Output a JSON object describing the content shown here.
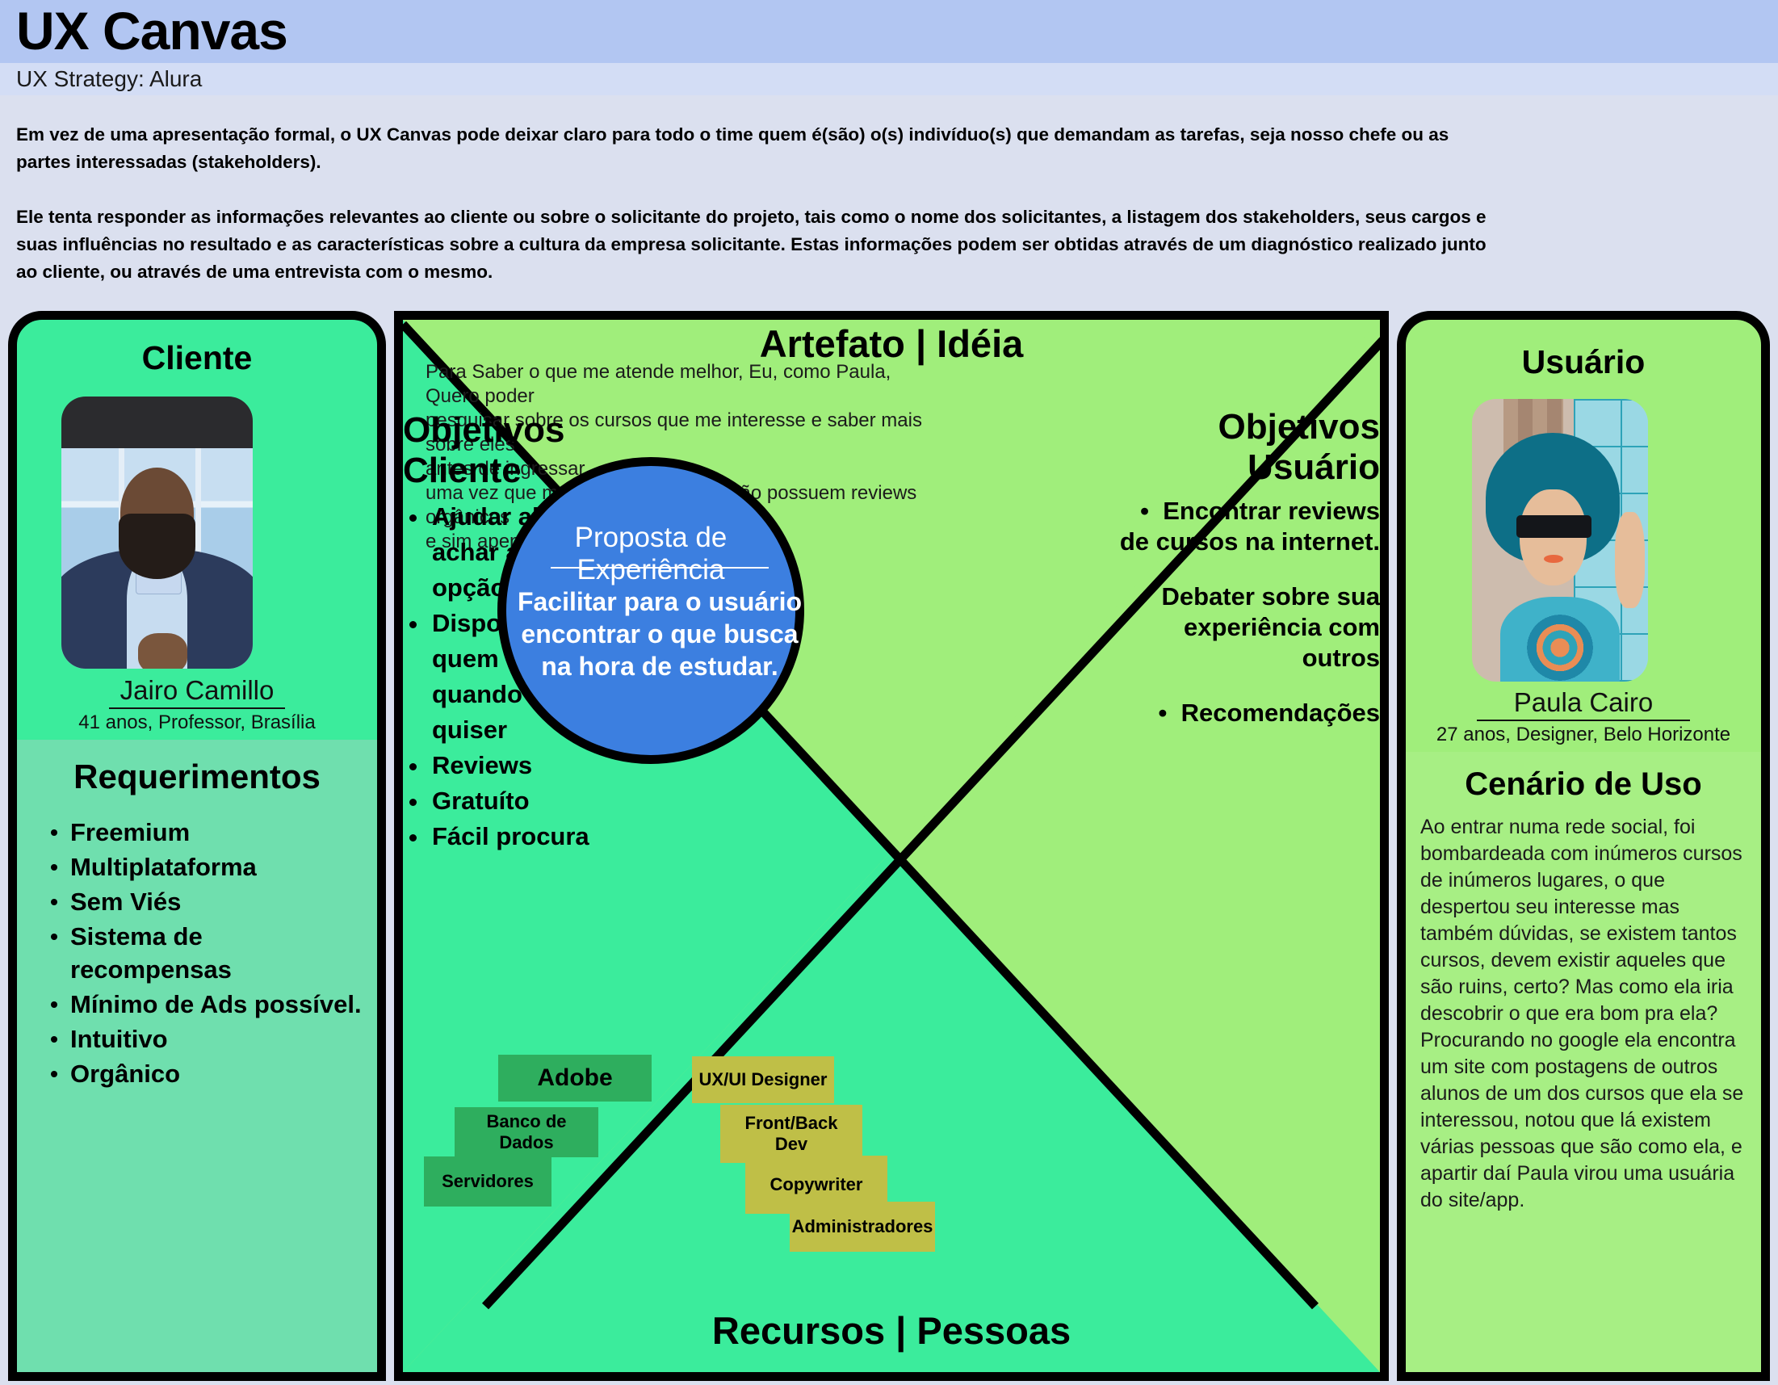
{
  "header": {
    "title": "UX Canvas",
    "subtitle": "UX Strategy: Alura",
    "intro_paragraphs": [
      "Em vez de uma apresentação formal, o UX Canvas pode deixar claro para todo o time quem é(são) o(s) indivíduo(s) que demandam as tarefas, seja nosso chefe ou as partes interessadas (stakeholders).",
      "Ele tenta responder as informações relevantes ao cliente ou sobre o solicitante do projeto, tais como o nome dos solicitantes, a listagem dos stakeholders, seus cargos e suas influências no resultado e as características sobre a cultura da empresa solicitante. Estas informações podem ser obtidas através de um diagnóstico realizado junto ao cliente, ou através de uma entrevista com o mesmo."
    ]
  },
  "cliente": {
    "title": "Cliente",
    "name": "Jairo Camillo",
    "role": "41 anos, Professor, Brasília",
    "requirements_title": "Requerimentos",
    "requirements": [
      "Freemium",
      "Multiplataforma",
      "Sem Viés",
      "Sistema de recompensas",
      "Mínimo de Ads possível.",
      "Intuitivo",
      "Orgânico"
    ]
  },
  "center": {
    "artefato_title": "Artefato | Idéia",
    "artefato_lines": [
      "Para Saber o que me atende melhor, Eu, como Paula, Quero poder",
      "pesquisar sobre os cursos que me interesse e saber mais sobre eles",
      "antes de ingressar,",
      "uma vez que muitos destes cursos não possuem reviews orgânicos",
      "e sim apenas a favor deles."
    ],
    "objetivos_cliente_title": "Objetivos Cliente",
    "objetivos_cliente": [
      "Ajudar alunos a achar a melhor opção",
      "Disponível para quem quiser, quando e onde quiser",
      "Reviews",
      "Gratuíto",
      "Fácil procura"
    ],
    "objetivos_usuario_title": "Objetivos Usuário",
    "objetivos_usuario": [
      "Encontrar reviews de cursos na internet.",
      "Debater sobre sua experiência com outros",
      "Recomendações"
    ],
    "circle_title": "Proposta de Experiência",
    "circle_body": "Facilitar para o usuário encontrar o que busca na hora de estudar.",
    "recursos_title": "Recursos | Pessoas",
    "recursos_tags": [
      {
        "label": "Adobe",
        "type": "resource"
      },
      {
        "label": "Banco de Dados",
        "type": "resource"
      },
      {
        "label": "Servidores",
        "type": "resource"
      }
    ],
    "pessoas_tags": [
      {
        "label": "UX/UI Designer",
        "type": "people"
      },
      {
        "label": "Front/Back Dev",
        "type": "people"
      },
      {
        "label": "Copywriter",
        "type": "people"
      },
      {
        "label": "Administradores",
        "type": "people"
      }
    ]
  },
  "usuario": {
    "title": "Usuário",
    "name": "Paula Cairo",
    "role": "27 anos, Designer, Belo Horizonte",
    "cenario_title": "Cenário de Uso",
    "cenario_body": "Ao entrar numa rede social, foi bombardeada com inúmeros cursos de inúmeros lugares, o que despertou seu interesse mas também dúvidas, se existem tantos cursos, devem existir aqueles que são ruins, certo? Mas como ela iria descobrir o que era bom pra ela? Procurando no google ela encontra um site com postagens de outros alunos de um dos cursos que ela se interessou, notou que lá existem várias pessoas que são como ela, e apartir daí Paula virou uma usuária do site/app."
  },
  "colors": {
    "header_band": "#B2C6F2",
    "subtitle_band": "#D3DDF5",
    "page_bg": "#DBE0EF",
    "teal": "#3BEC9C",
    "teal_muted": "#6FDFAE",
    "light_green": "#A0EE7B",
    "circle_blue": "#3C7FE0",
    "tag_resource": "#2EAE5E",
    "tag_people": "#BFBF47",
    "outline": "#000000"
  }
}
